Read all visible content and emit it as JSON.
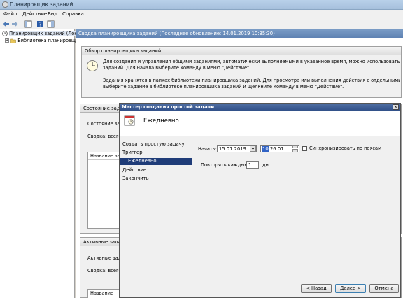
{
  "window": {
    "title": "Планировщик заданий"
  },
  "menu": [
    "Файл",
    "Действие",
    "Вид",
    "Справка"
  ],
  "tree": {
    "root": "Планировщик заданий (Локал",
    "child": "Библиотека планировщ"
  },
  "main": {
    "header": "Сводка планировщика заданий (Последнее обновление: 14.01.2019 10:35:30)",
    "overview_title": "Обзор планировщика заданий",
    "overview_p1": "Для создания и управления общими заданиями, автоматически выполняемыми в указанное время, можно использовать планировщ",
    "overview_p1b": "заданий. Для начала выберите команду в меню \"Действие\".",
    "overview_p2": "Задания хранятся в папках библиотеки планировщика заданий. Для просмотра или выполнения действия с отдельными заданиями",
    "overview_p2b": "выберите задание в библиотеке планировщика заданий и щелкните команду в меню \"Действие\".",
    "status_title": "Состояние зада",
    "status_label": "Состояние задач",
    "summary_label": "Сводка: всего",
    "col_name": "Название зада",
    "active_title": "Активные задач",
    "active_label": "Активные зада",
    "active_summary": "Сводка: всего",
    "active_col": "Название задан"
  },
  "dialog": {
    "title": "Мастер создания простой задачи",
    "heading": "Ежедневно",
    "steps": [
      "Создать простую задачу",
      "Триггер",
      "Ежедневно",
      "Действие",
      "Закончить"
    ],
    "selected_step": 2,
    "start_label": "Начать:",
    "start_date": "15.01.2019",
    "start_time_sel": "10",
    "start_time_rest": ":26:01",
    "sync_label": "Синхронизировать по поясам",
    "repeat_label": "Повторять каждые:",
    "repeat_value": "1",
    "repeat_unit": "дн.",
    "back_button": "< Назад",
    "next_button": "Далее >",
    "cancel_button": "Отмена"
  }
}
